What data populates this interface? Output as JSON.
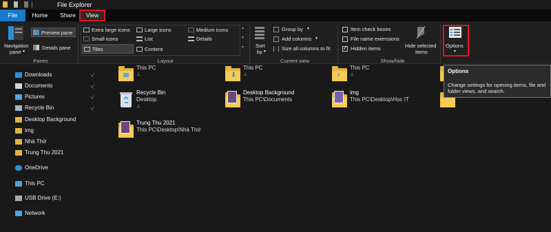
{
  "window": {
    "title": "File Explorer"
  },
  "tabs": {
    "file": "File",
    "home": "Home",
    "share": "Share",
    "view": "View"
  },
  "ribbon": {
    "panes": {
      "nav_line1": "Navigation",
      "nav_line2": "pane",
      "preview": "Preview pane",
      "details": "Details pane",
      "group": "Panes"
    },
    "layout": {
      "extra_large": "Extra large icons",
      "large": "Large icons",
      "medium": "Medium icons",
      "small": "Small icons",
      "list": "List",
      "details": "Details",
      "tiles": "Tiles",
      "content": "Content",
      "group": "Layout"
    },
    "current_view": {
      "sort_line1": "Sort",
      "sort_line2": "by",
      "group_by": "Group by",
      "add_columns": "Add columns",
      "size_columns": "Size all columns to fit",
      "group": "Current view"
    },
    "show_hide": {
      "item_checkboxes": "Item check boxes",
      "file_ext": "File name extensions",
      "hidden_items": "Hidden items",
      "hide_selected_line1": "Hide selected",
      "hide_selected_line2": "items",
      "group": "Show/hide",
      "item_checkboxes_checked": false,
      "file_ext_checked": false,
      "hidden_items_checked": true
    },
    "options": {
      "label": "Options"
    }
  },
  "tooltip": {
    "title": "Options",
    "desc": "Change settings for opening items, file and folder views, and search."
  },
  "nav": {
    "items": [
      {
        "label": "Downloads",
        "icon": "downloads-icon",
        "pinned": true
      },
      {
        "label": "Documents",
        "icon": "documents-icon",
        "pinned": true
      },
      {
        "label": "Pictures",
        "icon": "pictures-icon",
        "pinned": true
      },
      {
        "label": "Recycle Bin",
        "icon": "recycle-bin-icon",
        "pinned": true
      },
      {
        "label": "Desktop Background",
        "icon": "folder-icon",
        "pinned": false
      },
      {
        "label": "img",
        "icon": "folder-icon",
        "pinned": false
      },
      {
        "label": "Nhà Thờ",
        "icon": "folder-icon",
        "pinned": false
      },
      {
        "label": "Trung Thu 2021",
        "icon": "folder-icon",
        "pinned": false
      },
      {
        "label": "OneDrive",
        "icon": "onedrive-icon",
        "pinned": false
      },
      {
        "label": "This PC",
        "icon": "this-pc-icon",
        "pinned": false
      },
      {
        "label": "USB Drive (E:)",
        "icon": "usb-drive-icon",
        "pinned": false
      },
      {
        "label": "Network",
        "icon": "network-icon",
        "pinned": false
      }
    ],
    "pin_glyph": "📌"
  },
  "tiles": [
    {
      "name": "",
      "sub": "This PC",
      "pinned": true
    },
    {
      "name": "",
      "sub": "This PC",
      "pinned": true
    },
    {
      "name": "",
      "sub": "This PC",
      "pinned": true
    },
    {
      "name": "",
      "sub": "",
      "pinned": false
    },
    {
      "name": "Recycle Bin",
      "sub": "Desktop",
      "pinned": true
    },
    {
      "name": "Desktop Background",
      "sub": "This PC\\Documents",
      "pinned": false
    },
    {
      "name": "img",
      "sub": "This PC\\Desktop\\Học IT",
      "pinned": false
    },
    {
      "name": "",
      "sub": "This PC\\Desktop",
      "pinned": false
    },
    {
      "name": "Trung Thu 2021",
      "sub": "This PC\\Desktop\\Nhà Thờ",
      "pinned": false
    }
  ],
  "colors": {
    "accent": "#1979ca",
    "highlight": "#e81123",
    "folder": "#e3b440"
  }
}
